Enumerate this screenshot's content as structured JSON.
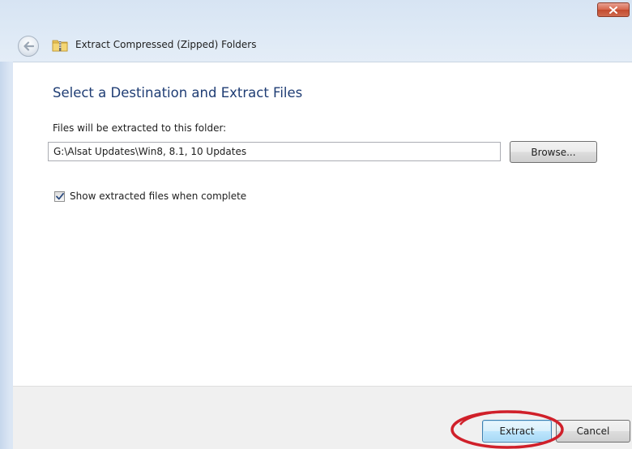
{
  "window": {
    "title": "Extract Compressed (Zipped) Folders",
    "close_icon": "close-icon",
    "back_icon": "back-arrow-icon",
    "folder_icon": "zip-folder-icon"
  },
  "main": {
    "heading": "Select a Destination and Extract Files",
    "path_label": "Files will be extracted to this folder:",
    "path_value": "G:\\Alsat Updates\\Win8, 8.1, 10 Updates",
    "browse_label": "Browse...",
    "show_files_checked": true,
    "show_files_label": "Show extracted files when complete"
  },
  "footer": {
    "extract_label": "Extract",
    "cancel_label": "Cancel"
  },
  "colors": {
    "heading": "#1f3d74",
    "annotation": "#d0202a",
    "close_button": "#c94f34",
    "chrome": "#dbe6f4"
  }
}
